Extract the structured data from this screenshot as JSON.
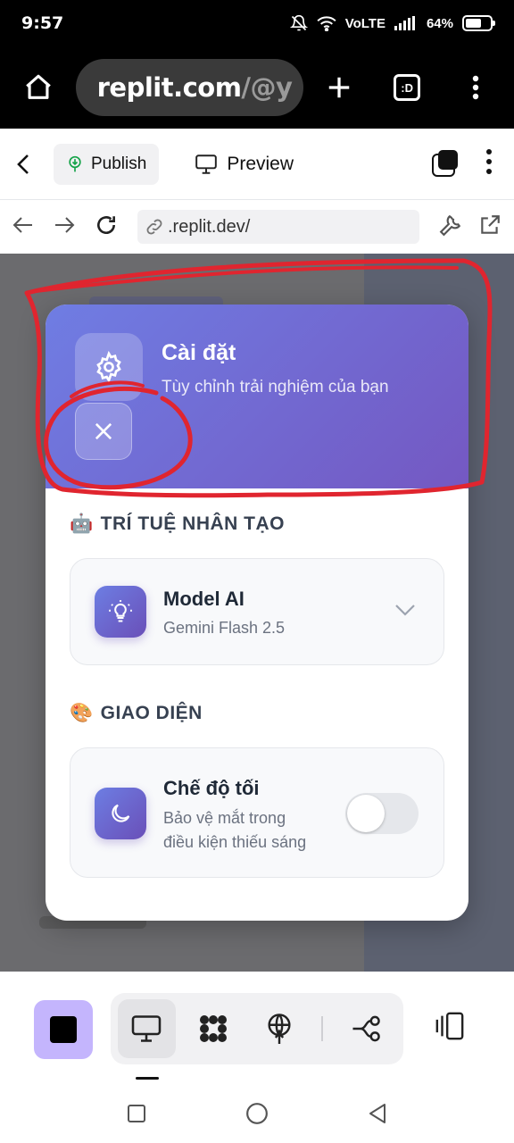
{
  "status_bar": {
    "time": "9:57",
    "network_label": "VoLTE",
    "battery_percent": "64%",
    "battery_level": 0.64
  },
  "browser": {
    "url_main": "replit.com",
    "url_path": "/@y",
    "tab_label": ":D"
  },
  "replit_header": {
    "publish_label": "Publish",
    "preview_label": "Preview"
  },
  "address_bar": {
    "url": ".replit.dev/"
  },
  "modal": {
    "title": "Cài đặt",
    "subtitle": "Tùy chỉnh trải nghiệm của bạn",
    "sections": [
      {
        "emoji": "🤖",
        "title": "TRÍ TUỆ NHÂN TẠO",
        "card_title": "Model AI",
        "card_sub": "Gemini Flash 2.5"
      },
      {
        "emoji": "🎨",
        "title": "GIAO DIỆN",
        "card_title": "Chế độ tối",
        "card_sub_line1": "Bảo vệ mắt trong",
        "card_sub_line2": "điều kiện thiếu sáng",
        "toggle_on": false
      }
    ]
  },
  "colors": {
    "header_gradient_start": "#6f7de3",
    "header_gradient_end": "#7458c2",
    "annotation_red": "#e0252f",
    "accent_purple": "#c4b5fd"
  }
}
